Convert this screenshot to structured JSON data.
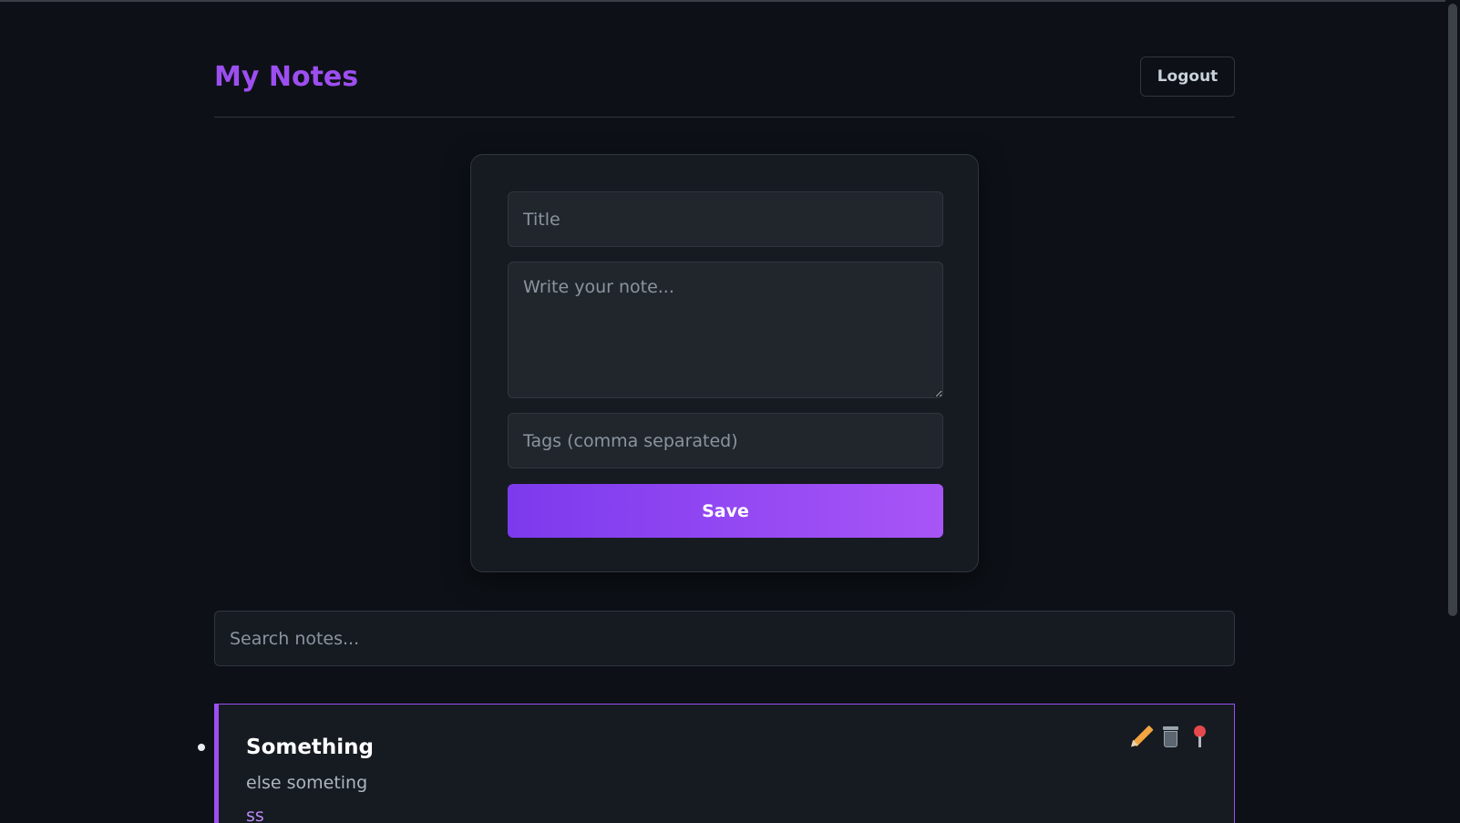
{
  "header": {
    "title": "My Notes",
    "logout_label": "Logout"
  },
  "editor": {
    "title_placeholder": "Title",
    "note_placeholder": "Write your note...",
    "tags_placeholder": "Tags (comma separated)",
    "save_label": "Save"
  },
  "search": {
    "placeholder": "Search notes..."
  },
  "notes": [
    {
      "title": "Something",
      "body": "else someting",
      "tags": "ss",
      "actions": [
        "pencil-icon",
        "trash-icon",
        "pin-icon"
      ]
    }
  ],
  "colors": {
    "background": "#0d1117",
    "accent": "#9d4ef0",
    "button_gradient_start": "#7c3aed",
    "button_gradient_end": "#a855f7",
    "card": "#161b22",
    "border": "#30363d"
  }
}
